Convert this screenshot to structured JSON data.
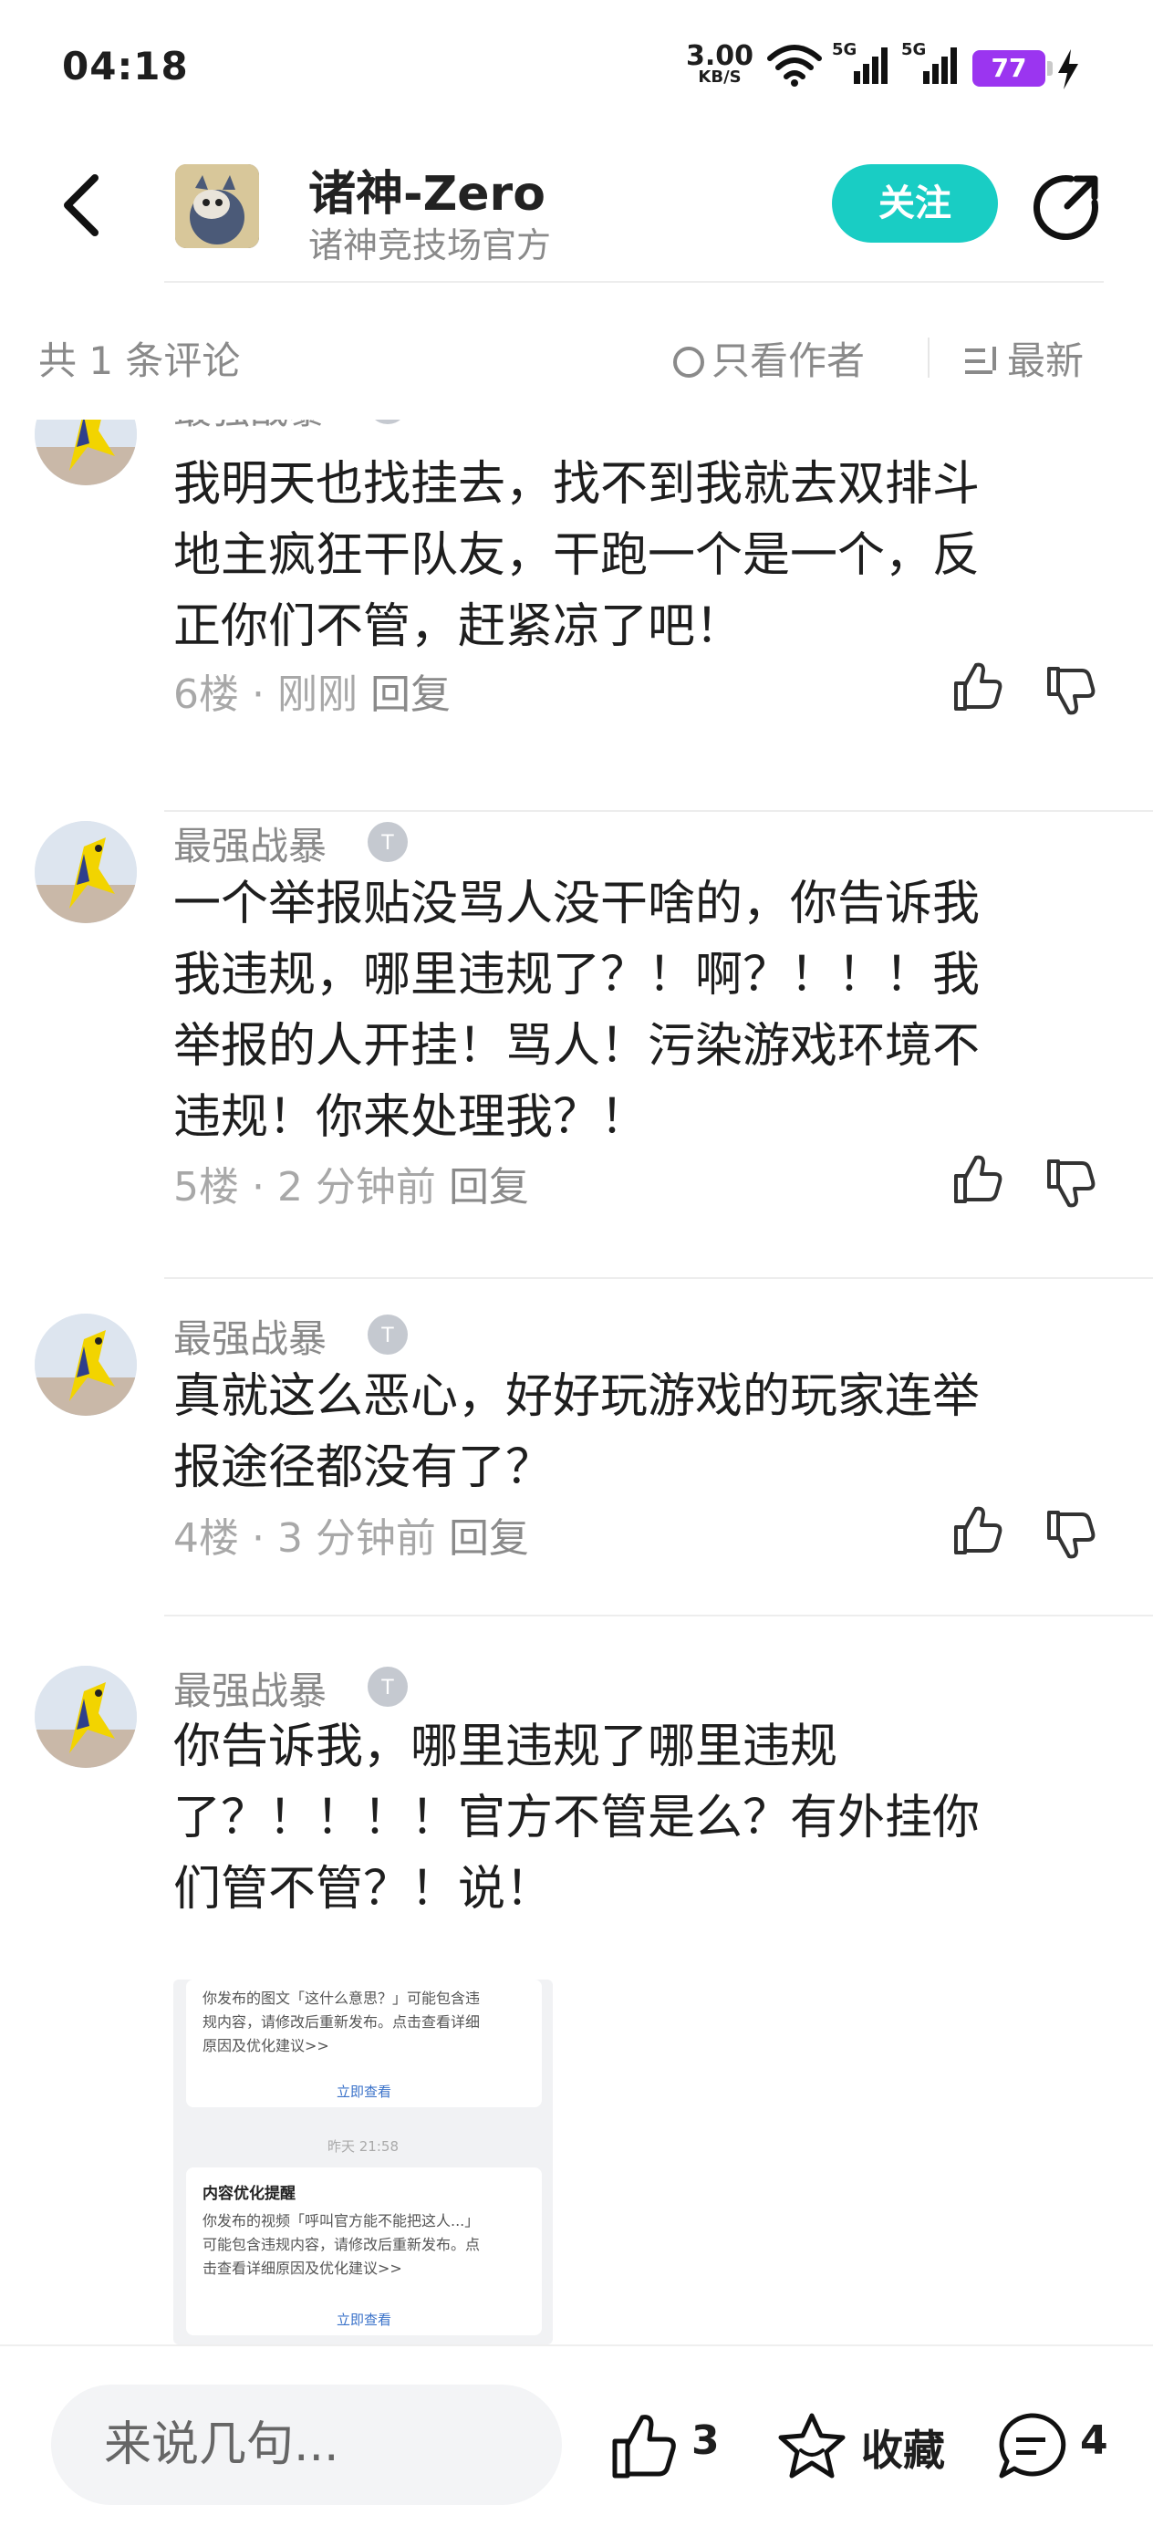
{
  "status_bar": {
    "time": "04:18",
    "speed": "3.00",
    "speed_unit": "KB/S",
    "net1": "5G",
    "net2": "5G",
    "battery": "77"
  },
  "header": {
    "title": "诸神-Zero",
    "subtitle": "诸神竞技场官方",
    "follow_label": "关注"
  },
  "comment_bar": {
    "count_label": "共 1 条评论",
    "author_only_label": "只看作者",
    "sort_label": "最新"
  },
  "comments": [
    {
      "user": "最强战暴",
      "text_lines": [
        "我明天也找挂去，找不到我就去双排斗",
        "地主疯狂干队友，干跑一个是一个，反",
        "正你们不管，赶紧凉了吧！"
      ],
      "meta": "6楼 · 刚刚",
      "reply": "回复"
    },
    {
      "user": "最强战暴",
      "text_lines": [
        "一个举报贴没骂人没干啥的，你告诉我",
        "我违规，哪里违规了？！啊？！！！我",
        "举报的人开挂！骂人！污染游戏环境不",
        "违规！你来处理我？！"
      ],
      "meta": "5楼 · 2 分钟前",
      "reply": "回复"
    },
    {
      "user": "最强战暴",
      "text_lines": [
        "真就这么恶心，好好玩游戏的玩家连举",
        "报途径都没有了？"
      ],
      "meta": "4楼 · 3 分钟前",
      "reply": "回复"
    },
    {
      "user": "最强战暴",
      "text_lines": [
        "你告诉我，哪里违规了哪里违规",
        "了？！！！！官方不管是么？有外挂你",
        "们管不管？！说！"
      ]
    }
  ],
  "embedded_screenshot": {
    "card1_lines": [
      "你发布的图文「这什么意思？」可能包含违",
      "规内容，请修改后重新发布。点击查看详细",
      "原因及优化建议>>"
    ],
    "card1_link": "立即查看",
    "timestamp": "昨天 21:58",
    "card2_title": "内容优化提醒",
    "card2_lines": [
      "你发布的视频「呼叫官方能不能把这人...」",
      "可能包含违规内容，请修改后重新发布。点",
      "击查看详细原因及优化建议>>"
    ],
    "card2_link": "立即查看"
  },
  "bottom_bar": {
    "input_placeholder": "来说几句...",
    "like_count": "3",
    "favorite_label": "收藏",
    "comment_count": "4"
  },
  "colors": {
    "accent": "#19cdc4",
    "battery": "#9b35f0",
    "muted": "#8a8a8a"
  }
}
